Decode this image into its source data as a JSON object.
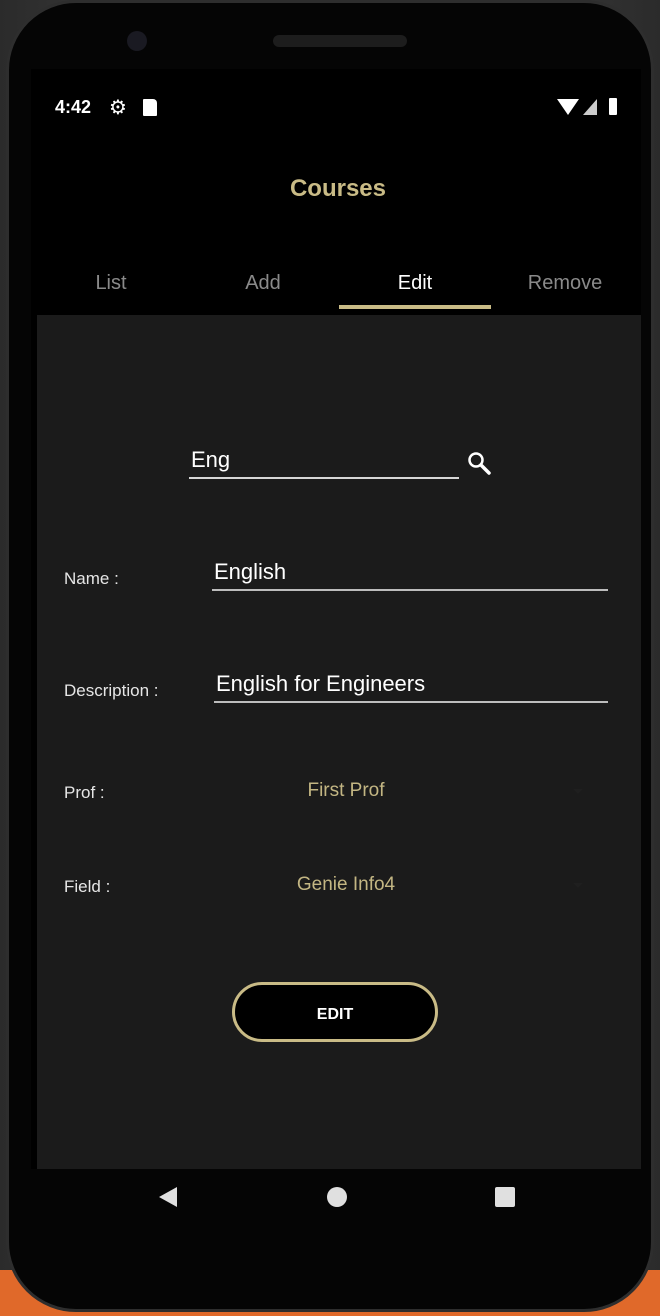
{
  "status_bar": {
    "time": "4:42",
    "icons": [
      "gear-icon",
      "sim-icon",
      "wifi-icon",
      "signal-icon",
      "battery-icon"
    ]
  },
  "app": {
    "title": "Courses",
    "accent_color": "#c9bb86"
  },
  "tabs": [
    {
      "label": "List",
      "active": false
    },
    {
      "label": "Add",
      "active": false
    },
    {
      "label": "Edit",
      "active": true
    },
    {
      "label": "Remove",
      "active": false
    }
  ],
  "search": {
    "value": "Eng",
    "icon": "search-icon"
  },
  "form": {
    "name_label": "Name :",
    "name_value": "English",
    "description_label": "Description :",
    "description_value": "English for Engineers",
    "prof_label": "Prof :",
    "prof_selected": "First Prof",
    "field_label": "Field :",
    "field_selected": "Genie Info4"
  },
  "actions": {
    "edit_label": "EDIT"
  },
  "navigation": {
    "icons": [
      "back-icon",
      "home-icon",
      "recents-icon"
    ]
  }
}
